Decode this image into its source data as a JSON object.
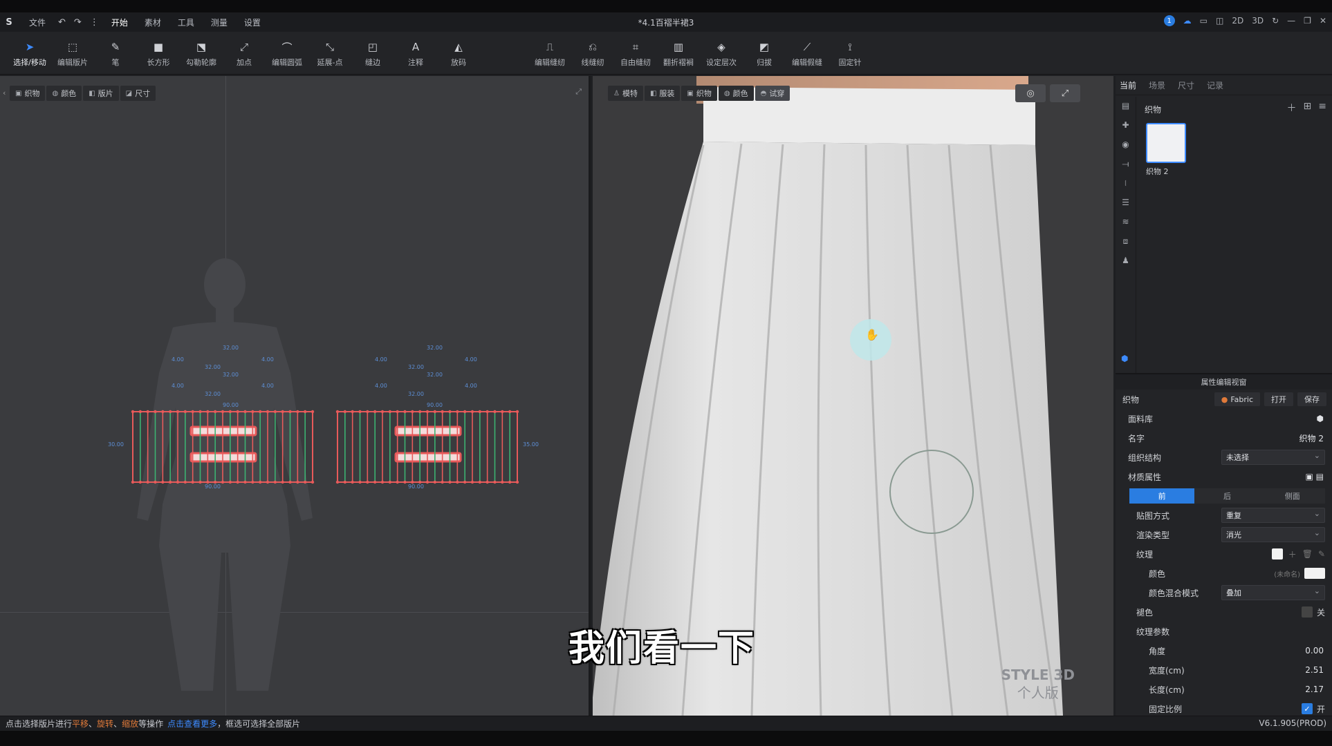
{
  "app": {
    "document_title": "*4.1百褶半裙3",
    "menu": [
      "文件",
      "开始",
      "素材",
      "工具",
      "测量",
      "设置"
    ],
    "notification_count": "1",
    "view_modes": [
      "2D",
      "3D"
    ]
  },
  "toolbar": {
    "left_tools": [
      "选择/移动",
      "编辑版片",
      "笔",
      "长方形",
      "勾勒轮廓",
      "加点",
      "编辑圆弧",
      "延展-点",
      "缝边",
      "注释",
      "放码"
    ],
    "right_tools": [
      "编辑缝纫",
      "线缝纫",
      "自由缝纫",
      "翻折褶裥",
      "设定层次",
      "归拔",
      "编辑假缝",
      "固定针"
    ]
  },
  "panel2d": {
    "tabs": [
      "织物",
      "颜色",
      "版片",
      "尺寸"
    ],
    "measures": {
      "band_top": "32.00",
      "band_mid": "32.00",
      "band_side": "4.00",
      "panel_top": "90.00",
      "panel_bottom": "90.00",
      "panel_left": "30.00",
      "panel_right": "35.00"
    }
  },
  "panel3d": {
    "tabs": [
      "模特",
      "服装",
      "织物",
      "颜色",
      "试穿"
    ],
    "watermark_line1": "STYLE 3D",
    "watermark_line2": "个人版",
    "subtitle": "我们看一下"
  },
  "sidebar": {
    "tabs": [
      "当前",
      "场景",
      "尺寸",
      "记录"
    ],
    "fabric_title": "织物",
    "fabric_item": "织物 2"
  },
  "properties": {
    "header": "属性编辑视窗",
    "section": "织物",
    "fabric_btn": "Fabric",
    "open_btn": "打开",
    "save_btn": "保存",
    "library_label": "面料库",
    "name_label": "名字",
    "name_value": "织物 2",
    "weave_label": "组织结构",
    "weave_value": "未选择",
    "material_label": "材质属性",
    "sides": [
      "前",
      "后",
      "侧面"
    ],
    "mapping_label": "贴图方式",
    "mapping_value": "重复",
    "render_label": "渲染类型",
    "render_value": "消光",
    "texture_label": "纹理",
    "color_label": "颜色",
    "color_hint": "(未命名)",
    "blend_label": "颜色混合模式",
    "blend_value": "叠加",
    "tint_label": "褪色",
    "tint_state": "关",
    "tex_params_label": "纹理参数",
    "angle_label": "角度",
    "angle_value": "0.00",
    "width_label": "宽度(cm)",
    "width_value": "2.51",
    "length_label": "长度(cm)",
    "length_value": "2.17",
    "ratio_label": "固定比例",
    "ratio_state": "开"
  },
  "status": {
    "pre": "点击选择版片进行",
    "op1": "平移",
    "op2": "旋转",
    "op3": "缩放",
    "mid": "等操作",
    "link": "点击查看更多",
    "post": "，框选可选择全部版片",
    "version": "V6.1.905(PROD)"
  },
  "colors": {
    "accent": "#2a7de1",
    "pattern_outline": "#e85a5a",
    "seam_green": "#3cb371"
  }
}
